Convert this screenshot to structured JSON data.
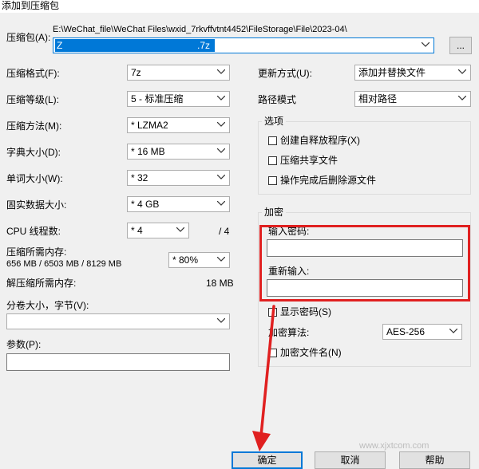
{
  "window": {
    "title": "添加到压缩包"
  },
  "archive": {
    "label": "压缩包(A):",
    "path": "E:\\WeChat_file\\WeChat Files\\wxid_7rkvffvtnt4452\\FileStorage\\File\\2023-04\\",
    "filename_prefix": "Z",
    "filename_suffix": ".7z",
    "browse_label": "..."
  },
  "left": {
    "format": {
      "label": "压缩格式(F):",
      "value": "7z"
    },
    "level": {
      "label": "压缩等级(L):",
      "value": "5 - 标准压缩"
    },
    "method": {
      "label": "压缩方法(M):",
      "value": "* LZMA2"
    },
    "dict": {
      "label": "字典大小(D):",
      "value": "* 16 MB"
    },
    "word": {
      "label": "单词大小(W):",
      "value": "* 32"
    },
    "solid": {
      "label": "固实数据大小:",
      "value": "* 4 GB"
    },
    "threads": {
      "label": "CPU 线程数:",
      "value": "* 4",
      "total": "/ 4"
    },
    "memory": {
      "label": "压缩所需内存:",
      "detail": "656 MB / 6503 MB / 8129 MB",
      "value": "* 80%"
    },
    "decomp": {
      "label": "解压缩所需内存:",
      "value": "18 MB"
    },
    "split": {
      "label": "分卷大小，字节(V):",
      "value": ""
    },
    "params": {
      "label": "参数(P):",
      "value": ""
    }
  },
  "right": {
    "update": {
      "label": "更新方式(U):",
      "value": "添加并替换文件"
    },
    "pathmode": {
      "label": "路径模式",
      "value": "相对路径"
    },
    "options": {
      "title": "选项",
      "items": [
        "创建自释放程序(X)",
        "压缩共享文件",
        "操作完成后删除源文件"
      ]
    },
    "encrypt": {
      "title": "加密",
      "password_label": "输入密码:",
      "repeat_label": "重新输入:",
      "show_label": "显示密码(S)",
      "method_label": "加密算法:",
      "method_value": "AES-256",
      "names_label": "加密文件名(N)"
    }
  },
  "buttons": {
    "ok": "确定",
    "cancel": "取消",
    "help": "帮助"
  },
  "watermark": "www.xjxtcom.com"
}
